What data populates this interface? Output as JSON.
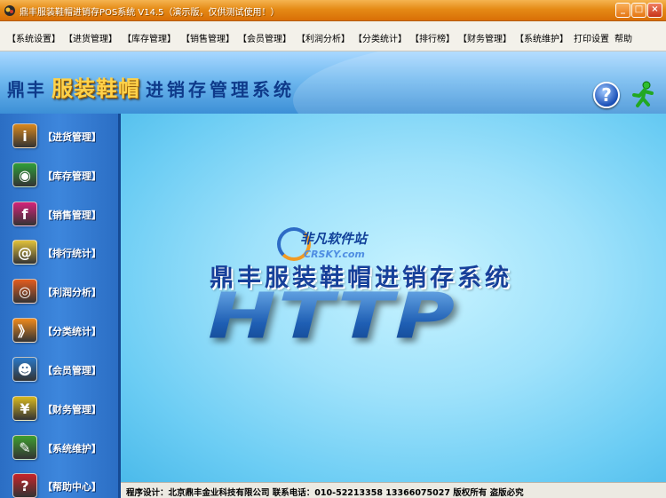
{
  "window": {
    "title": "鼎丰服装鞋帽进销存POS系统 V14.5（演示版，仅供测试使用！）",
    "minimize_glyph": "_",
    "maximize_glyph": "□",
    "close_glyph": "×"
  },
  "menu": {
    "items": [
      "【系统设置】",
      "【进货管理】",
      "【库存管理】",
      "【销售管理】",
      "【会员管理】",
      "【利润分析】",
      "【分类统计】",
      "【排行榜】",
      "【财务管理】",
      "【系统维护】",
      "打印设置",
      "帮助"
    ]
  },
  "header": {
    "brand_prefix": "鼎丰",
    "brand_highlight": "服装鞋帽",
    "brand_suffix": "进销存管理系统",
    "help_glyph": "?"
  },
  "sidebar": {
    "items": [
      {
        "label": "【进货管理】",
        "icon": "info-icon",
        "glyph": "i",
        "color": "#d9881c"
      },
      {
        "label": "【库存管理】",
        "icon": "chat-bubble-icon",
        "glyph": "◉",
        "color": "#2f9e3a"
      },
      {
        "label": "【销售管理】",
        "icon": "facebook-icon",
        "glyph": "f",
        "color": "#d4237a"
      },
      {
        "label": "【排行统计】",
        "icon": "at-sign-icon",
        "glyph": "@",
        "color": "#e2c23a"
      },
      {
        "label": "【利润分析】",
        "icon": "target-icon",
        "glyph": "◎",
        "color": "#e35c1e"
      },
      {
        "label": "【分类统计】",
        "icon": "rss-icon",
        "glyph": "》",
        "color": "#f08a1c"
      },
      {
        "label": "【会员管理】",
        "icon": "users-icon",
        "glyph": "☻",
        "color": "#2a78c8"
      },
      {
        "label": "【财务管理】",
        "icon": "yen-icon",
        "glyph": "¥",
        "color": "#d8b91f"
      },
      {
        "label": "【系统维护】",
        "icon": "pencil-icon",
        "glyph": "✎",
        "color": "#3f9e2f"
      },
      {
        "label": "【帮助中心】",
        "icon": "help-book-icon",
        "glyph": "?",
        "color": "#c8242a"
      }
    ]
  },
  "main": {
    "watermark_name": "非凡软件站",
    "watermark_url": "CRSKY.com",
    "title": "鼎丰服装鞋帽进销存系统",
    "big_text": "HTTP"
  },
  "status": {
    "text": "程序设计：北京鼎丰金业科技有限公司    联系电话：010-52213358  13366075027   版权所有  盗版必究"
  }
}
